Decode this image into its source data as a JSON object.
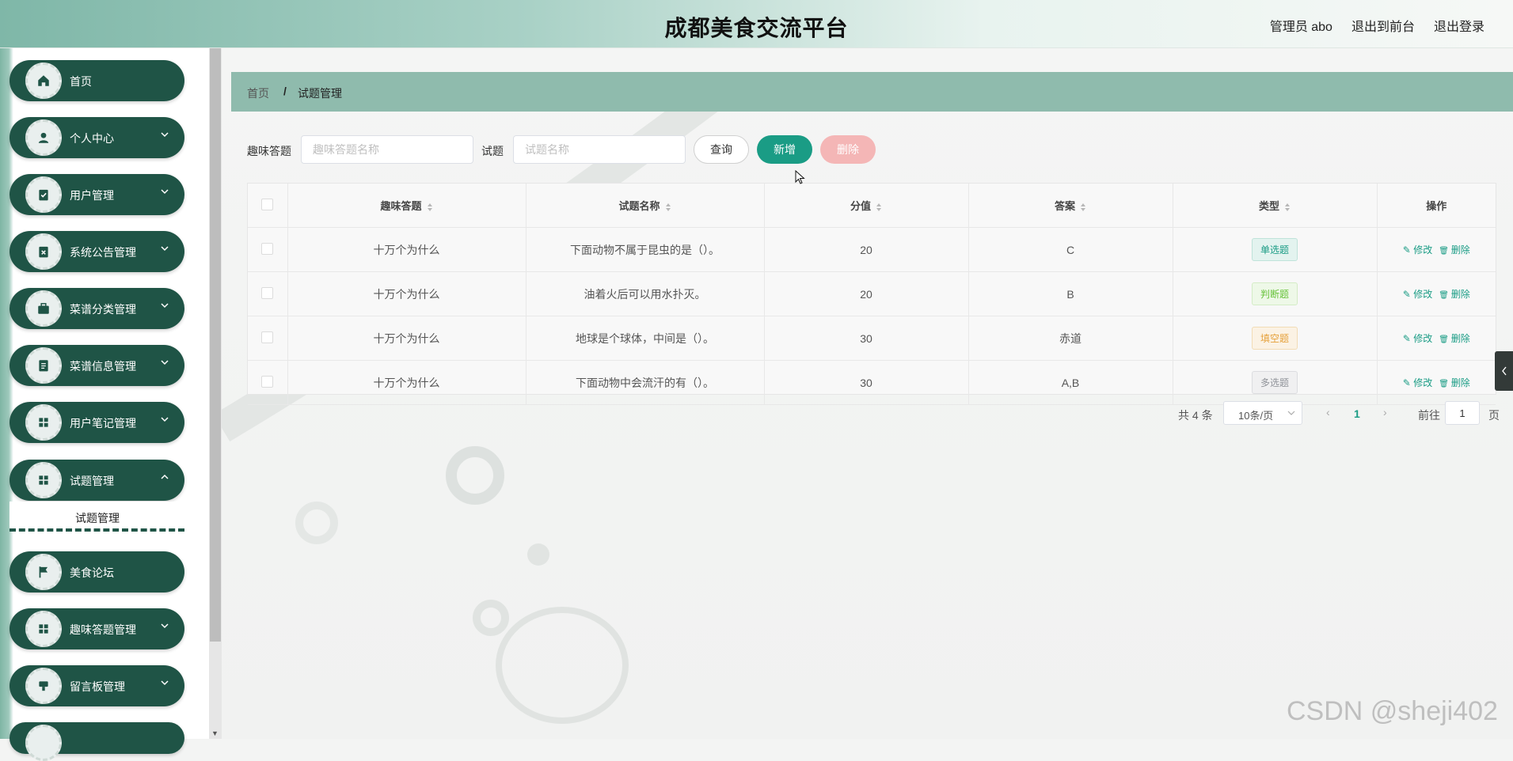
{
  "header": {
    "title": "成都美食交流平台",
    "user_label": "管理员 abo",
    "front_link": "退出到前台",
    "logout_link": "退出登录"
  },
  "sidebar": {
    "items": [
      {
        "label": "首页",
        "icon": "home-icon",
        "has_arrow": false
      },
      {
        "label": "个人中心",
        "icon": "person-icon",
        "has_arrow": true
      },
      {
        "label": "用户管理",
        "icon": "clipboard-check-icon",
        "has_arrow": true
      },
      {
        "label": "系统公告管理",
        "icon": "clipboard-x-icon",
        "has_arrow": true
      },
      {
        "label": "菜谱分类管理",
        "icon": "briefcase-icon",
        "has_arrow": true
      },
      {
        "label": "菜谱信息管理",
        "icon": "document-icon",
        "has_arrow": true
      },
      {
        "label": "用户笔记管理",
        "icon": "grid-icon",
        "has_arrow": true
      },
      {
        "label": "试题管理",
        "icon": "grid-icon",
        "has_arrow": true
      },
      {
        "label": "美食论坛",
        "icon": "flag-icon",
        "has_arrow": false
      },
      {
        "label": "趣味答题管理",
        "icon": "grid-icon",
        "has_arrow": true
      },
      {
        "label": "留言板管理",
        "icon": "message-icon",
        "has_arrow": true
      }
    ],
    "active_sub": "试题管理"
  },
  "breadcrumb": {
    "home": "首页",
    "separator": "/",
    "current": "试题管理"
  },
  "filters": {
    "quiz_label": "趣味答题",
    "quiz_placeholder": "趣味答题名称",
    "question_label": "试题",
    "question_placeholder": "试题名称",
    "query_btn": "查询",
    "add_btn": "新增",
    "delete_btn": "删除"
  },
  "table": {
    "columns": [
      "趣味答题",
      "试题名称",
      "分值",
      "答案",
      "类型",
      "操作"
    ],
    "rows": [
      {
        "quiz": "十万个为什么",
        "name": "下面动物不属于昆虫的是（）。",
        "score": "20",
        "answer": "C",
        "type": "单选题"
      },
      {
        "quiz": "十万个为什么",
        "name": "油着火后可以用水扑灭。",
        "score": "20",
        "answer": "B",
        "type": "判断题"
      },
      {
        "quiz": "十万个为什么",
        "name": "地球是个球体，中间是（）。",
        "score": "30",
        "answer": "赤道",
        "type": "填空题"
      },
      {
        "quiz": "十万个为什么",
        "name": "下面动物中会流汗的有（）。",
        "score": "30",
        "answer": "A,B",
        "type": "多选题"
      }
    ],
    "edit_label": "修改",
    "delete_label": "删除"
  },
  "tag_colors": {
    "单选题": {
      "color": "#1a9c85",
      "bg": "#e3f3ef",
      "border": "#bfe3da"
    },
    "判断题": {
      "color": "#67c23a",
      "bg": "#eef8e8",
      "border": "#d4ecc6"
    },
    "填空题": {
      "color": "#e6a23c",
      "bg": "#fbf2e4",
      "border": "#f2dcb6"
    },
    "多选题": {
      "color": "#909399",
      "bg": "#f0f0f1",
      "border": "#dcdde0"
    }
  },
  "pagination": {
    "total": "共 4 条",
    "page_size": "10条/页",
    "current_page": "1",
    "goto_label": "前往",
    "goto_value": "1",
    "page_suffix": "页"
  },
  "watermark": "CSDN @sheji402",
  "colors": {
    "accent": "#1a9c85",
    "sidebar_item": "#1f5446",
    "breadcrumb_bar": "#8fbbad"
  }
}
